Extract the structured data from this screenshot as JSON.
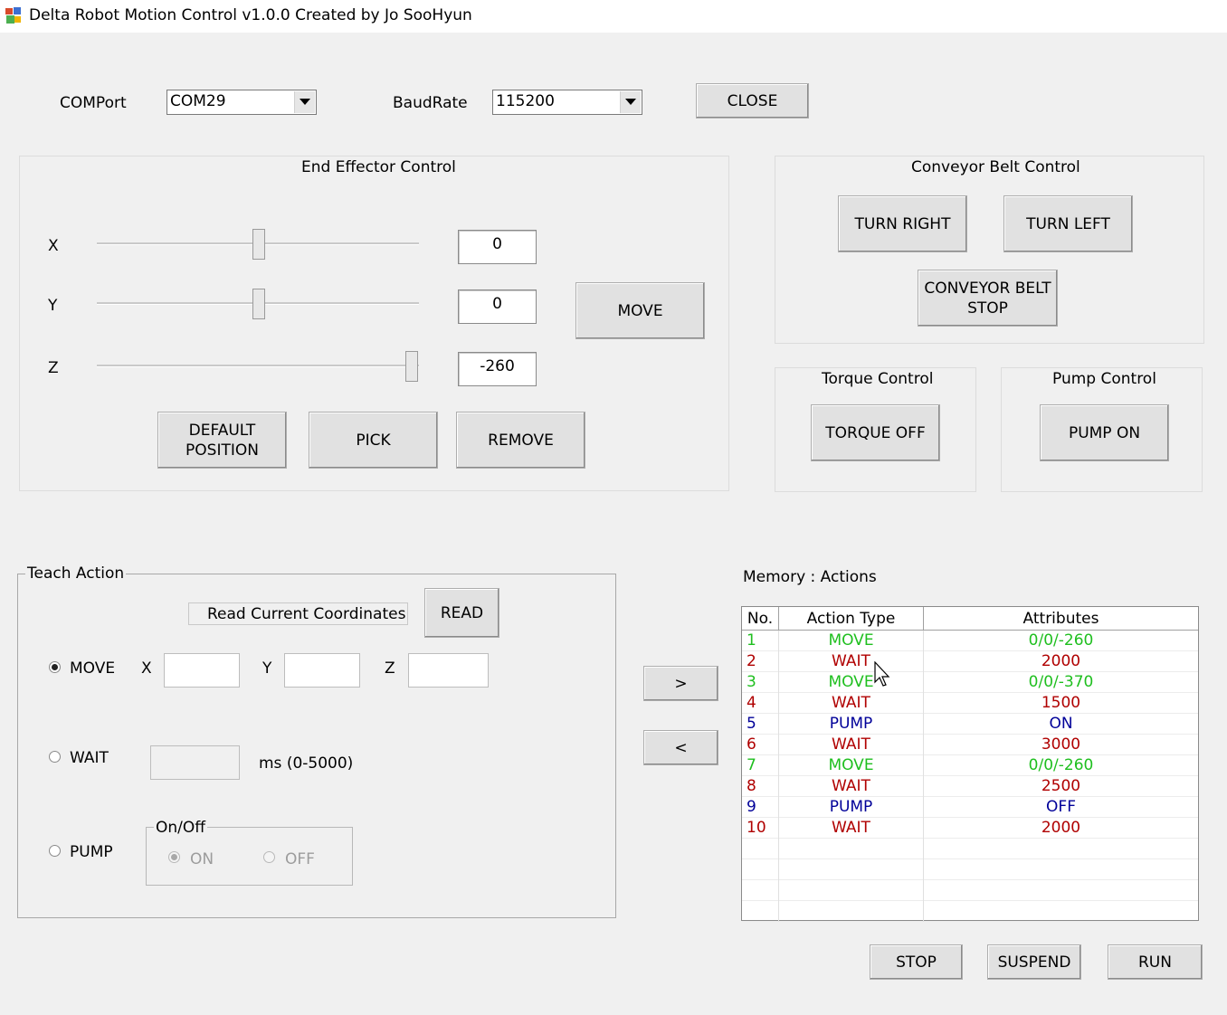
{
  "window": {
    "title": "Delta Robot Motion Control v1.0.0 Created by Jo SooHyun"
  },
  "connection": {
    "comport_label": "COMPort",
    "comport_value": "COM29",
    "baudrate_label": "BaudRate",
    "baudrate_value": "115200",
    "close_label": "CLOSE"
  },
  "end_effector": {
    "title": "End Effector Control",
    "x_label": "X",
    "y_label": "Y",
    "z_label": "Z",
    "x_value": "0",
    "y_value": "0",
    "z_value": "-260",
    "move_label": "MOVE",
    "default_label": "DEFAULT\nPOSITION",
    "pick_label": "PICK",
    "remove_label": "REMOVE"
  },
  "conveyor": {
    "title": "Conveyor Belt Control",
    "right_label": "TURN RIGHT",
    "left_label": "TURN LEFT",
    "stop_label": "CONVEYOR BELT\nSTOP"
  },
  "torque": {
    "title": "Torque Control",
    "button_label": "TORQUE OFF"
  },
  "pump": {
    "title": "Pump Control",
    "button_label": "PUMP ON"
  },
  "teach": {
    "title": "Teach Action",
    "read_coords_label": "Read Current Coordinates",
    "read_label": "READ",
    "move_label": "MOVE",
    "x_label": "X",
    "y_label": "Y",
    "z_label": "Z",
    "wait_label": "WAIT",
    "ms_label": "ms (0-5000)",
    "pump_label": "PUMP",
    "onoff_title": "On/Off",
    "on_label": "ON",
    "off_label": "OFF"
  },
  "transfer": {
    "add_label": ">",
    "remove_label": "<"
  },
  "memory": {
    "title": "Memory : Actions",
    "columns": [
      "No.",
      "Action Type",
      "Attributes"
    ],
    "rows": [
      {
        "no": "1",
        "type": "MOVE",
        "attr": "0/0/-260"
      },
      {
        "no": "2",
        "type": "WAIT",
        "attr": "2000"
      },
      {
        "no": "3",
        "type": "MOVE",
        "attr": "0/0/-370"
      },
      {
        "no": "4",
        "type": "WAIT",
        "attr": "1500"
      },
      {
        "no": "5",
        "type": "PUMP",
        "attr": "ON"
      },
      {
        "no": "6",
        "type": "WAIT",
        "attr": "3000"
      },
      {
        "no": "7",
        "type": "MOVE",
        "attr": "0/0/-260"
      },
      {
        "no": "8",
        "type": "WAIT",
        "attr": "2500"
      },
      {
        "no": "9",
        "type": "PUMP",
        "attr": "OFF"
      },
      {
        "no": "10",
        "type": "WAIT",
        "attr": "2000"
      }
    ],
    "type_colors": {
      "MOVE": "#1fbf1f",
      "WAIT": "#b00000",
      "PUMP": "#000099"
    }
  },
  "run_controls": {
    "stop_label": "STOP",
    "suspend_label": "SUSPEND",
    "run_label": "RUN"
  }
}
